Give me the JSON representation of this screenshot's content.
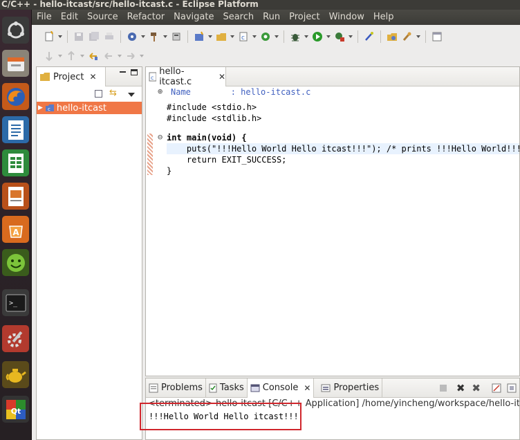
{
  "window": {
    "title": "C/C++ - hello-itcast/src/hello-itcast.c - Eclipse Platform"
  },
  "menubar": [
    "File",
    "Edit",
    "Source",
    "Refactor",
    "Navigate",
    "Search",
    "Run",
    "Project",
    "Window",
    "Help"
  ],
  "launcher": [
    "ubuntu-icon",
    "files-icon",
    "firefox-icon",
    "writer-icon",
    "calc-icon",
    "impress-icon",
    "software-center-icon",
    "smiley-icon",
    "terminal-icon",
    "settings-icon",
    "teapot-icon",
    "qt-icon"
  ],
  "project_explorer": {
    "tab_label": "Project",
    "tree": [
      {
        "label": "hello-itcast"
      }
    ]
  },
  "editor": {
    "tab_label": "hello-itcast.c",
    "lines": [
      {
        "t": "Name        : hello-itcast.c"
      },
      {
        "t": "#include <stdio.h>"
      },
      {
        "t": "#include <stdlib.h>"
      },
      {
        "t": "int main(void) {"
      },
      {
        "t": "    puts(\"!!!Hello World Hello itcast!!!\"); /* prints !!!Hello World!!! */"
      },
      {
        "t": "    return EXIT_SUCCESS;"
      },
      {
        "t": "}"
      }
    ]
  },
  "bottom_panel": {
    "tabs": [
      "Problems",
      "Tasks",
      "Console",
      "Properties"
    ],
    "active_tab": "Console",
    "status": "<terminated> hello-itcast [C/C++ Application] /home/yincheng/workspace/hello-itcast/Debug/h",
    "output": "!!!Hello World Hello itcast!!!"
  },
  "colors": {
    "selection": "#f07746",
    "highlight_box": "#d0262c",
    "launcher_bg": "#2c2228"
  }
}
